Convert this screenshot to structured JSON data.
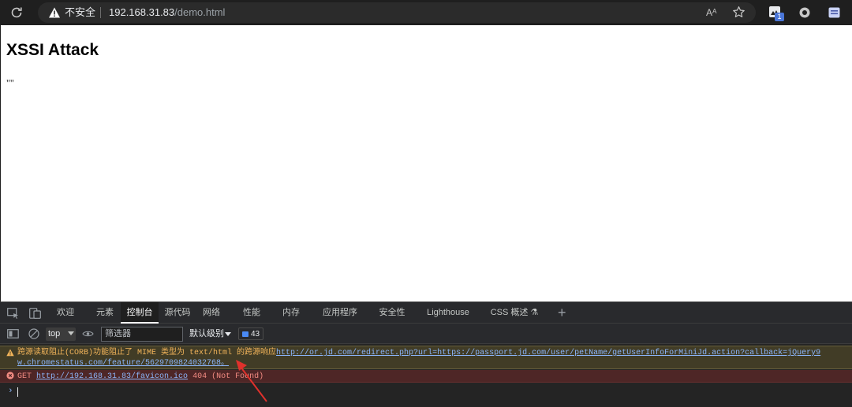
{
  "browser": {
    "security_label": "不安全",
    "url_host": "192.168.31.83",
    "url_path": "/demo.html",
    "read_aloud_glyph": "Aᴬ",
    "extension_badge": "1"
  },
  "page": {
    "heading": "XSSI Attack",
    "result_text": "\"\""
  },
  "devtools": {
    "tabs": [
      "欢迎",
      "元素",
      "控制台",
      "源代码",
      "网络",
      "性能",
      "内存",
      "应用程序",
      "安全性",
      "Lighthouse",
      "CSS 概述 ⚗"
    ],
    "active_tab": "控制台",
    "context": "top",
    "filter_placeholder": "筛选器",
    "levels_label": "默认级别",
    "message_count": "43",
    "warning": {
      "text": "跨源读取阻止(CORB)功能阻止了 MIME 类型为 text/html 的跨源响应",
      "link": "http://or.jd.com/redirect.php?url=https://passport.jd.com/user/petName/getUserInfoForMiniJd.action?callback=jQuery9",
      "line2": "w.chromestatus.com/feature/5629709824032768。"
    },
    "error": {
      "method": "GET",
      "link": "http://192.168.31.83/favicon.ico",
      "status": "404 (Not Found)"
    },
    "prompt": "›"
  },
  "colors": {
    "warning_bg": "#413c26",
    "warning_text": "#f2b45a",
    "error_bg": "#4e2626",
    "error_text": "#f28b82",
    "link": "#8ab4f8",
    "annotation_arrow": "#e0312c"
  }
}
